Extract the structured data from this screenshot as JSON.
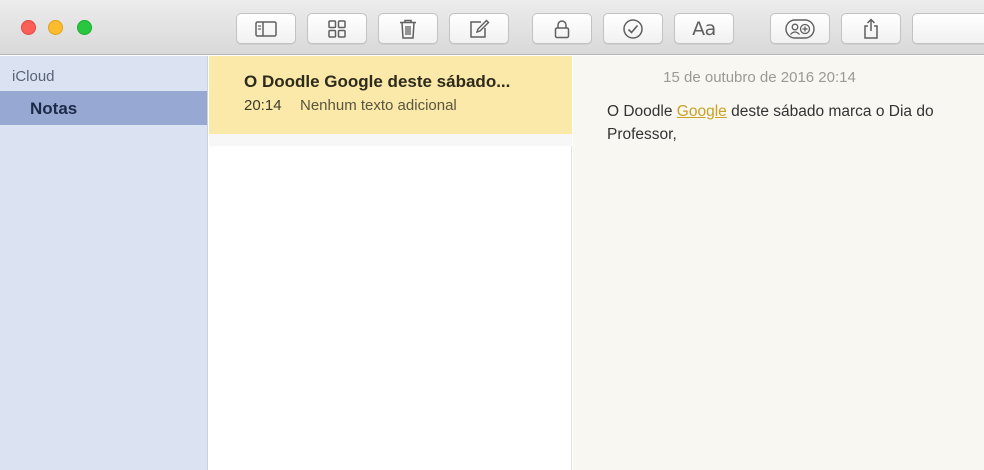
{
  "window": {
    "traffic_lights": [
      "close",
      "minimize",
      "zoom"
    ]
  },
  "toolbar": {
    "buttons": [
      {
        "name": "sidebar-toggle",
        "icon": "sidebar-icon"
      },
      {
        "name": "attachments-browser",
        "icon": "grid-icon"
      },
      {
        "name": "delete",
        "icon": "trash-icon"
      },
      {
        "name": "new-note",
        "icon": "compose-icon"
      },
      {
        "name": "lock",
        "icon": "lock-icon"
      },
      {
        "name": "checklist",
        "icon": "checkmark-circle-icon"
      },
      {
        "name": "format",
        "icon": "text-format-icon",
        "label": "Aa"
      },
      {
        "name": "add-people",
        "icon": "add-people-icon"
      },
      {
        "name": "share",
        "icon": "share-icon"
      }
    ]
  },
  "sidebar": {
    "section_label": "iCloud",
    "items": [
      {
        "label": "Notas",
        "selected": true
      }
    ]
  },
  "note_list": {
    "items": [
      {
        "title": "O Doodle Google deste sábado...",
        "time": "20:14",
        "preview": "Nenhum texto adicional",
        "selected": true
      }
    ]
  },
  "editor": {
    "date": "15 de outubro de 2016 20:14",
    "body_before_link": "O Doodle ",
    "body_link": "Google",
    "body_after_link": " deste sábado marca o Dia do Professor,"
  },
  "colors": {
    "sidebar_bg": "#dbe2f1",
    "sidebar_selected": "#97a8d2",
    "note_selected": "#fae9a9",
    "editor_bg": "#f9f7f1",
    "link": "#c9a227"
  }
}
